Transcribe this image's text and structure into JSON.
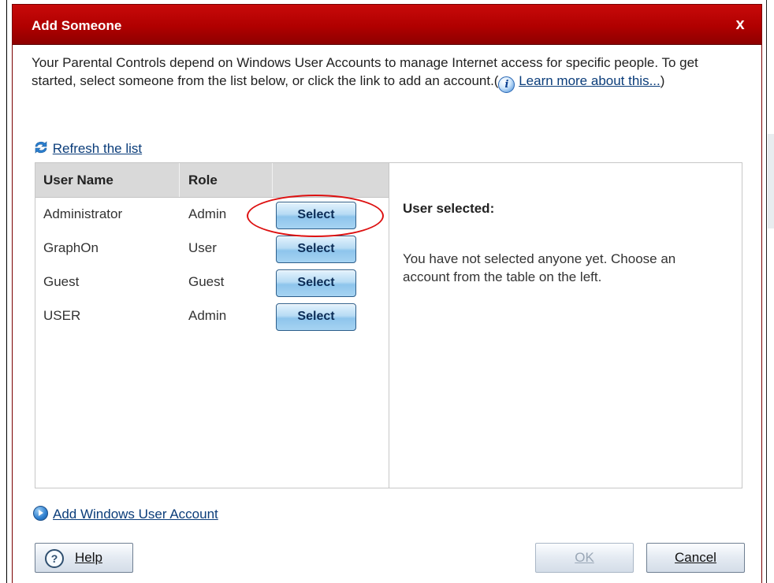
{
  "dialog": {
    "title": "Add Someone",
    "close_label": "x"
  },
  "intro": {
    "text": "Your Parental Controls depend on Windows User Accounts to manage Internet access for specific people. To get started, select someone from the list below, or click the link to add an account.(",
    "info_icon_glyph": "i",
    "learn_more": "Learn more about this...",
    "closing_paren": ")"
  },
  "refresh_label": "Refresh the list",
  "table": {
    "columns": [
      "User Name",
      "Role"
    ],
    "rows": [
      {
        "name": "Administrator",
        "role": "Admin",
        "action": "Select"
      },
      {
        "name": "GraphOn",
        "role": "User",
        "action": "Select"
      },
      {
        "name": "Guest",
        "role": "Guest",
        "action": "Select"
      },
      {
        "name": "USER",
        "role": "Admin",
        "action": "Select"
      }
    ]
  },
  "detail": {
    "label": "User selected:",
    "message": "You have not selected anyone yet. Choose an account from the table on the left."
  },
  "add_account_label": "Add Windows User Account",
  "buttons": {
    "help_glyph": "?",
    "help": "Help",
    "ok": "OK",
    "cancel": "Cancel"
  },
  "colors": {
    "title_bar": "#b00000",
    "link": "#0b3d7a",
    "highlight_ring": "#d11111"
  },
  "icons": [
    "close-icon",
    "info-icon",
    "refresh-icon",
    "arrow-circle-icon",
    "help-icon"
  ]
}
